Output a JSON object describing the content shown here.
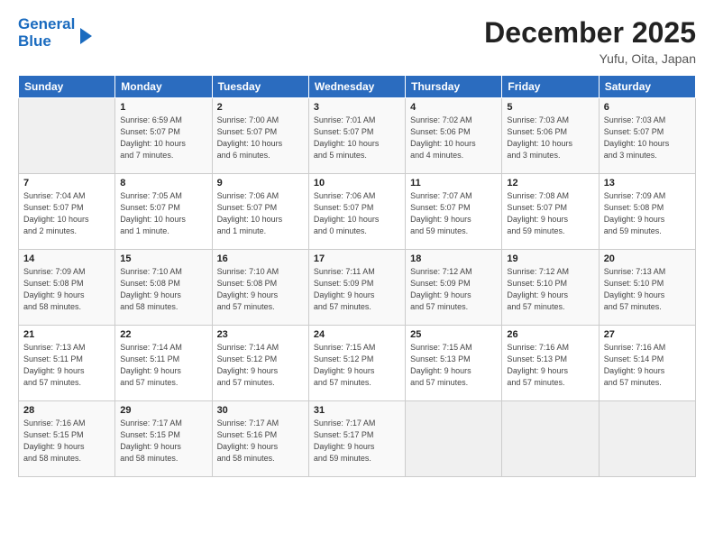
{
  "header": {
    "logo_line1": "General",
    "logo_line2": "Blue",
    "month": "December 2025",
    "location": "Yufu, Oita, Japan"
  },
  "days_of_week": [
    "Sunday",
    "Monday",
    "Tuesday",
    "Wednesday",
    "Thursday",
    "Friday",
    "Saturday"
  ],
  "weeks": [
    [
      {
        "day": "",
        "detail": ""
      },
      {
        "day": "1",
        "detail": "Sunrise: 6:59 AM\nSunset: 5:07 PM\nDaylight: 10 hours\nand 7 minutes."
      },
      {
        "day": "2",
        "detail": "Sunrise: 7:00 AM\nSunset: 5:07 PM\nDaylight: 10 hours\nand 6 minutes."
      },
      {
        "day": "3",
        "detail": "Sunrise: 7:01 AM\nSunset: 5:07 PM\nDaylight: 10 hours\nand 5 minutes."
      },
      {
        "day": "4",
        "detail": "Sunrise: 7:02 AM\nSunset: 5:06 PM\nDaylight: 10 hours\nand 4 minutes."
      },
      {
        "day": "5",
        "detail": "Sunrise: 7:03 AM\nSunset: 5:06 PM\nDaylight: 10 hours\nand 3 minutes."
      },
      {
        "day": "6",
        "detail": "Sunrise: 7:03 AM\nSunset: 5:07 PM\nDaylight: 10 hours\nand 3 minutes."
      }
    ],
    [
      {
        "day": "7",
        "detail": "Sunrise: 7:04 AM\nSunset: 5:07 PM\nDaylight: 10 hours\nand 2 minutes."
      },
      {
        "day": "8",
        "detail": "Sunrise: 7:05 AM\nSunset: 5:07 PM\nDaylight: 10 hours\nand 1 minute."
      },
      {
        "day": "9",
        "detail": "Sunrise: 7:06 AM\nSunset: 5:07 PM\nDaylight: 10 hours\nand 1 minute."
      },
      {
        "day": "10",
        "detail": "Sunrise: 7:06 AM\nSunset: 5:07 PM\nDaylight: 10 hours\nand 0 minutes."
      },
      {
        "day": "11",
        "detail": "Sunrise: 7:07 AM\nSunset: 5:07 PM\nDaylight: 9 hours\nand 59 minutes."
      },
      {
        "day": "12",
        "detail": "Sunrise: 7:08 AM\nSunset: 5:07 PM\nDaylight: 9 hours\nand 59 minutes."
      },
      {
        "day": "13",
        "detail": "Sunrise: 7:09 AM\nSunset: 5:08 PM\nDaylight: 9 hours\nand 59 minutes."
      }
    ],
    [
      {
        "day": "14",
        "detail": "Sunrise: 7:09 AM\nSunset: 5:08 PM\nDaylight: 9 hours\nand 58 minutes."
      },
      {
        "day": "15",
        "detail": "Sunrise: 7:10 AM\nSunset: 5:08 PM\nDaylight: 9 hours\nand 58 minutes."
      },
      {
        "day": "16",
        "detail": "Sunrise: 7:10 AM\nSunset: 5:08 PM\nDaylight: 9 hours\nand 57 minutes."
      },
      {
        "day": "17",
        "detail": "Sunrise: 7:11 AM\nSunset: 5:09 PM\nDaylight: 9 hours\nand 57 minutes."
      },
      {
        "day": "18",
        "detail": "Sunrise: 7:12 AM\nSunset: 5:09 PM\nDaylight: 9 hours\nand 57 minutes."
      },
      {
        "day": "19",
        "detail": "Sunrise: 7:12 AM\nSunset: 5:10 PM\nDaylight: 9 hours\nand 57 minutes."
      },
      {
        "day": "20",
        "detail": "Sunrise: 7:13 AM\nSunset: 5:10 PM\nDaylight: 9 hours\nand 57 minutes."
      }
    ],
    [
      {
        "day": "21",
        "detail": "Sunrise: 7:13 AM\nSunset: 5:11 PM\nDaylight: 9 hours\nand 57 minutes."
      },
      {
        "day": "22",
        "detail": "Sunrise: 7:14 AM\nSunset: 5:11 PM\nDaylight: 9 hours\nand 57 minutes."
      },
      {
        "day": "23",
        "detail": "Sunrise: 7:14 AM\nSunset: 5:12 PM\nDaylight: 9 hours\nand 57 minutes."
      },
      {
        "day": "24",
        "detail": "Sunrise: 7:15 AM\nSunset: 5:12 PM\nDaylight: 9 hours\nand 57 minutes."
      },
      {
        "day": "25",
        "detail": "Sunrise: 7:15 AM\nSunset: 5:13 PM\nDaylight: 9 hours\nand 57 minutes."
      },
      {
        "day": "26",
        "detail": "Sunrise: 7:16 AM\nSunset: 5:13 PM\nDaylight: 9 hours\nand 57 minutes."
      },
      {
        "day": "27",
        "detail": "Sunrise: 7:16 AM\nSunset: 5:14 PM\nDaylight: 9 hours\nand 57 minutes."
      }
    ],
    [
      {
        "day": "28",
        "detail": "Sunrise: 7:16 AM\nSunset: 5:15 PM\nDaylight: 9 hours\nand 58 minutes."
      },
      {
        "day": "29",
        "detail": "Sunrise: 7:17 AM\nSunset: 5:15 PM\nDaylight: 9 hours\nand 58 minutes."
      },
      {
        "day": "30",
        "detail": "Sunrise: 7:17 AM\nSunset: 5:16 PM\nDaylight: 9 hours\nand 58 minutes."
      },
      {
        "day": "31",
        "detail": "Sunrise: 7:17 AM\nSunset: 5:17 PM\nDaylight: 9 hours\nand 59 minutes."
      },
      {
        "day": "",
        "detail": ""
      },
      {
        "day": "",
        "detail": ""
      },
      {
        "day": "",
        "detail": ""
      }
    ]
  ]
}
